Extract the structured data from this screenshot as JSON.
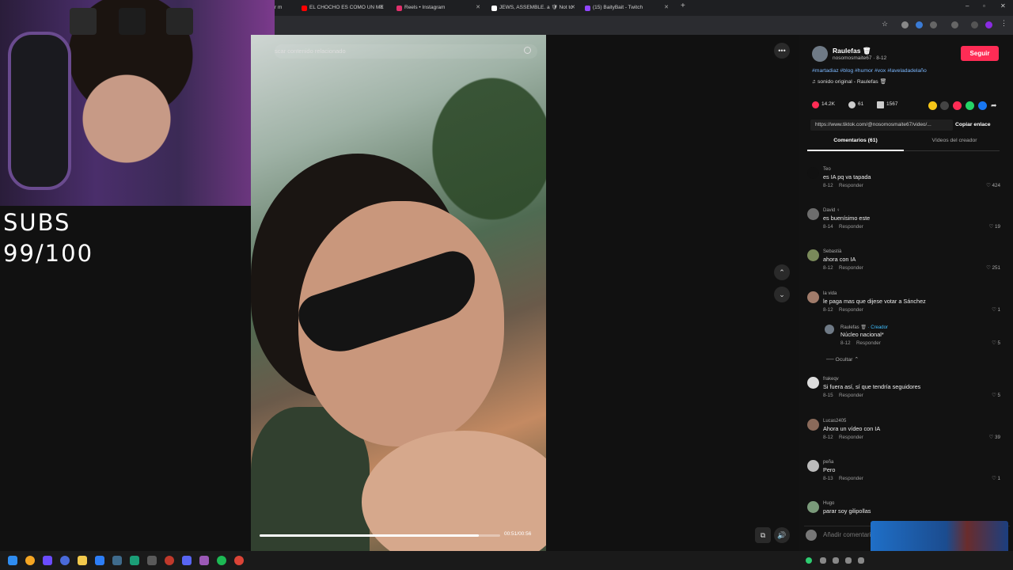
{
  "overlay": {
    "subs_label": "SUBS",
    "subs_count": "99/100"
  },
  "tabs": [
    {
      "label": "r m",
      "color": "#888888"
    },
    {
      "label": "EL CHOCHO ES COMO UN ME",
      "color": "#ff0000"
    },
    {
      "label": "Reels • Instagram",
      "color": "#e1306c"
    },
    {
      "label": "JEWS, ASSEMBLE. a 🛡 Not to",
      "color": "#ffffff"
    },
    {
      "label": "(15) BaityBait - Twitch",
      "color": "#9146ff"
    }
  ],
  "search": {
    "placeholder": "scar contenido relacionado"
  },
  "video": {
    "time": "00:51/00:56",
    "progress": 0.91
  },
  "author": {
    "name": "Raulefas 🗑",
    "sub": "nosomosmaite67 · 8-12",
    "follow_label": "Seguir",
    "hashtags": "#martadiaz #blog #humor #vox #laveladadelaño",
    "sound": "♫  sonido original - Raulefas 🗑"
  },
  "stats": {
    "likes": "14.2K",
    "comments": "61",
    "saves": "1567"
  },
  "link": {
    "url": "https://www.tiktok.com/@nosomosmaite67/video/...",
    "copy_label": "Copiar enlace"
  },
  "panel_tabs": {
    "comments": "Comentarios (61)",
    "creator_videos": "Vídeos del creador"
  },
  "comments": [
    {
      "name": "Teo",
      "text": "es IA pq va tapada",
      "date": "8-12",
      "reply": "Responder",
      "likes": "♡ 424",
      "color": "#111111"
    },
    {
      "name": "David ♀",
      "text": "es buenísimo este",
      "date": "8-14",
      "reply": "Responder",
      "likes": "♡ 19",
      "color": "#6d6d6d"
    },
    {
      "name": "Sebastià",
      "text": "ahora con IA",
      "date": "8-12",
      "reply": "Responder",
      "likes": "♡ 251",
      "color": "#7a8a5a"
    },
    {
      "name": "la vida",
      "text": "le paga mas que dijese votar a Sánchez",
      "date": "8-12",
      "reply": "Responder",
      "likes": "♡ 1",
      "color": "#a07b6a"
    },
    {
      "name": "frakeqv",
      "text": "Si fuera así, sí que tendría seguidores",
      "date": "8-15",
      "reply": "Responder",
      "likes": "♡ 5",
      "color": "#dddddd"
    },
    {
      "name": "Lucas2405",
      "text": "Ahora un vídeo con IA",
      "date": "8-12",
      "reply": "Responder",
      "likes": "♡ 39",
      "color": "#8a6a5a"
    },
    {
      "name": "peña",
      "text": "Pero",
      "date": "8-13",
      "reply": "Responder",
      "likes": "♡ 1",
      "color": "#bbbbbb"
    },
    {
      "name": "Hugo",
      "text": "parar soy gilipollas",
      "date": "",
      "reply": "",
      "likes": "",
      "color": "#7a9a7a"
    }
  ],
  "reply": {
    "name": "Raulefas 🗑",
    "tag": " · Creador",
    "text": "Núcleo nacional*",
    "date": "8-12",
    "reply": "Responder",
    "likes": "♡ 5"
  },
  "hide_label": "Ocultar ⌃",
  "add_comment": {
    "placeholder": "Añadir comentario..."
  },
  "colors": {
    "accent": "#fe2c55",
    "link": "#7cb8ff"
  }
}
